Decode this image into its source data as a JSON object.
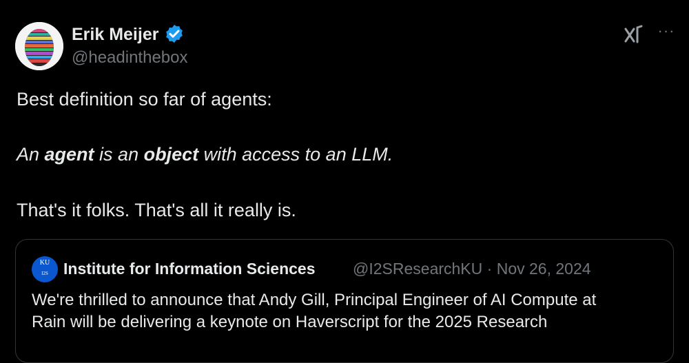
{
  "author": {
    "name": "Erik Meijer",
    "handle": "@headinthebox",
    "avatar_icon": "egg-avatar-icon",
    "verified_icon": "verified-badge-icon",
    "badge_color": "#1d9bf0"
  },
  "header_icons": {
    "grok": "grok-icon",
    "more": "···"
  },
  "post": {
    "line1": "Best definition so far of agents:",
    "line2": {
      "p1": "An ",
      "b1": "agent",
      "p2": " is an ",
      "b2": "object",
      "p3": " with access to an LLM."
    },
    "line3": "That's it folks. That's all it really is."
  },
  "quoted": {
    "avatar_line1": "KU",
    "avatar_line2": "I2S",
    "name": "Institute for Information Sciences",
    "handle": "@I2SResearchKU",
    "separator": " · ",
    "date": "Nov 26, 2024",
    "text_line1": "We're thrilled to announce that Andy Gill, Principal Engineer of AI Compute at",
    "text_line2": "Rain will be delivering a keynote on Haverscript for the 2025 Research"
  },
  "colors": {
    "background": "#000000",
    "text": "#e7e9ea",
    "muted": "#71767b",
    "border": "#333639",
    "quote_avatar_bg": "#0b57d0"
  }
}
